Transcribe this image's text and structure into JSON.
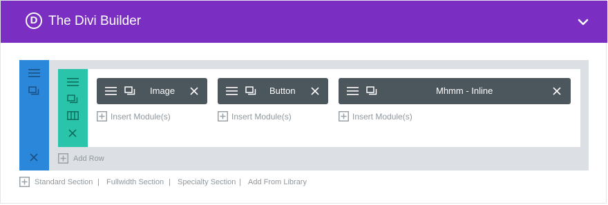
{
  "header": {
    "logo_letter": "D",
    "title": "The Divi Builder",
    "background_color": "#7b2fc2"
  },
  "section": {
    "color": "#2b87da",
    "icons": [
      "hamburger-icon",
      "duplicate-icon",
      "close-icon"
    ]
  },
  "row": {
    "color": "#29c4a9",
    "icons": [
      "hamburger-icon",
      "duplicate-icon",
      "columns-icon",
      "close-icon"
    ]
  },
  "modules": [
    {
      "label": "Image",
      "insert_label": "Insert Module(s)"
    },
    {
      "label": "Button",
      "insert_label": "Insert Module(s)"
    },
    {
      "label": "Mhmm - Inline",
      "insert_label": "Insert Module(s)"
    }
  ],
  "add_row_label": "Add Row",
  "footer": {
    "standard_section": "Standard Section",
    "fullwidth_section": "Fullwidth Section",
    "specialty_section": "Specialty Section",
    "add_from_library": "Add From Library",
    "separator": "|"
  },
  "colors": {
    "module_bg": "#4b565d",
    "builder_bg": "#dce0e4",
    "muted_text": "#8f979d"
  }
}
